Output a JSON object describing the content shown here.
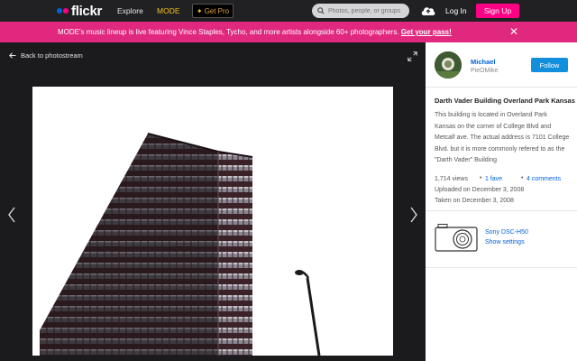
{
  "nav": {
    "logo_text": "flickr",
    "explore": "Explore",
    "mode": "MODE",
    "get_pro": "Get Pro",
    "search_placeholder": "Photos, people, or groups",
    "login": "Log In",
    "signup": "Sign Up"
  },
  "banner": {
    "text": "MODE's music lineup is live featuring Vince Staples, Tycho, and more artists alongside 60+ photographers.",
    "link": "Get your pass!"
  },
  "photo_view": {
    "back_label": "Back to photostream"
  },
  "owner": {
    "name": "Michael",
    "alias": "PieOMike",
    "follow_label": "Follow"
  },
  "photo": {
    "title": "Darth Vader Building Overland Park Kansas",
    "description": "This building is located in Overland Park Kansas on the corner of College Blvd and Metcalf ave. The actual address is 7101 College Blvd. but it is more commonly refered to as the \"Darth Vader\" Building",
    "views": "1,714 views",
    "faves": "1 fave",
    "comments": "4 comments",
    "uploaded": "Uploaded on December 3, 2008",
    "taken": "Taken on December 3, 2008"
  },
  "camera": {
    "model": "Sony DSC-H50",
    "show_settings": "Show settings"
  },
  "colors": {
    "brand_blue": "#0063dc",
    "brand_pink": "#ff0084",
    "banner_pink": "#e1287f",
    "follow_blue": "#128fdc"
  }
}
